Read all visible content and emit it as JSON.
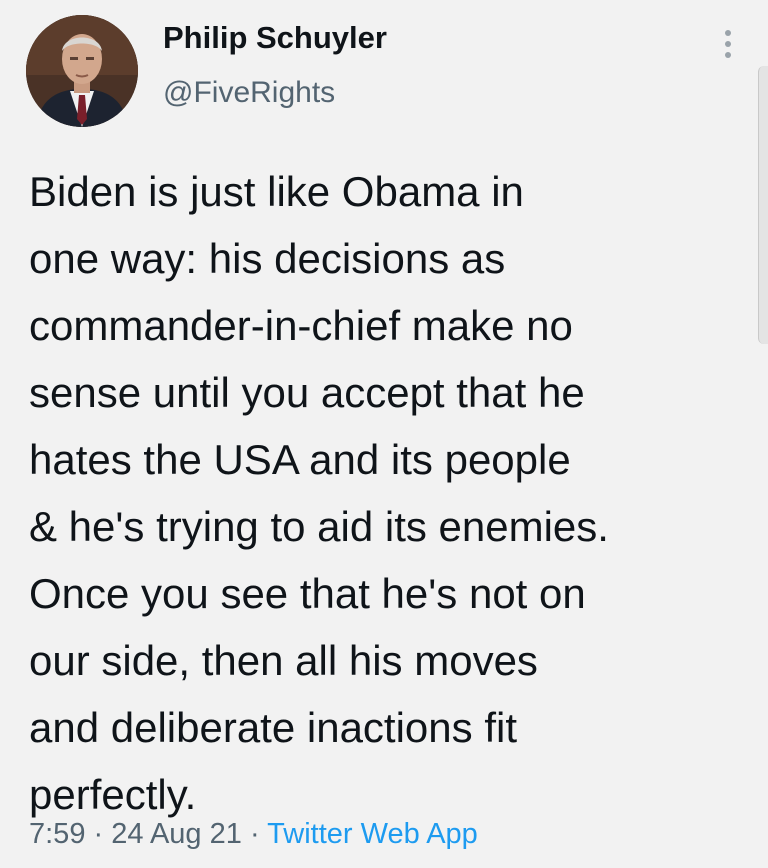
{
  "author": {
    "display_name": "Philip Schuyler",
    "handle": "@FiveRights"
  },
  "more_icon": "more-vertical-icon",
  "tweet": {
    "lines": [
      "Biden is just like Obama in",
      "one way: his decisions as",
      "commander-in-chief make no",
      "sense until you accept that he",
      "hates the USA and its people",
      "& he's trying to aid its enemies.",
      "Once you see that he's not on",
      "our side, then all his moves",
      "and deliberate inactions fit",
      "perfectly."
    ]
  },
  "meta": {
    "time": "7:59",
    "separator": "·",
    "date": "24 Aug 21",
    "source": "Twitter Web App"
  },
  "colors": {
    "background": "#f2f2f2",
    "text": "#0f1419",
    "secondary": "#536471",
    "link": "#1d9bf0"
  }
}
